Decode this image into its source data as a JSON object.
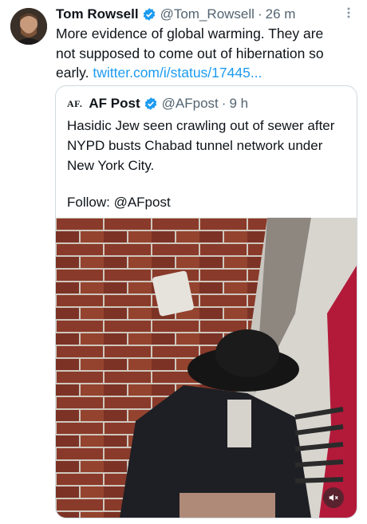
{
  "tweet": {
    "author_name": "Tom Rowsell",
    "handle": "@Tom_Rowsell",
    "separator": "·",
    "time": "26 m",
    "text_line1": "More evidence of global warming. They are",
    "text_line2": "not supposed to come out of hibernation so",
    "text_line3_prefix": "early.",
    "link": "twitter.com/i/status/17445..."
  },
  "quote": {
    "logo_text": "AF.",
    "author_name": "AF Post",
    "handle": "@AFpost",
    "separator": "·",
    "time": "9 h",
    "text": "Hasidic Jew seen crawling out of sewer after NYPD busts Chabad tunnel network under New York City.",
    "follow": "Follow: @AFpost"
  },
  "icons": {
    "verified": "verified-badge-icon",
    "more": "more-options-icon",
    "mute": "muted-speaker-icon"
  },
  "colors": {
    "link": "#1d9bf0",
    "secondary_text": "#536471",
    "border": "#cfd9de",
    "verified": "#1d9bf0"
  }
}
